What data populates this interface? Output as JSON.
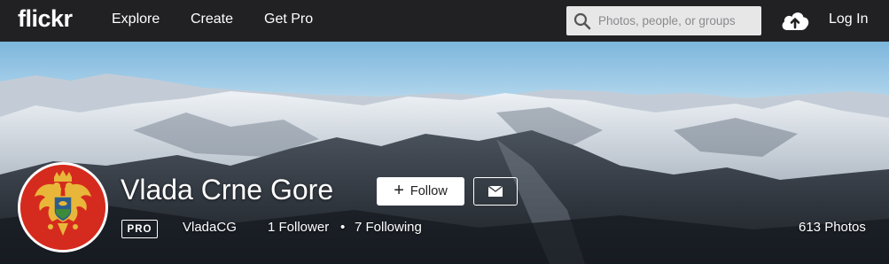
{
  "header": {
    "logo": "flickr",
    "nav": [
      {
        "label": "Explore"
      },
      {
        "label": "Create"
      },
      {
        "label": "Get Pro"
      }
    ],
    "search": {
      "placeholder": "Photos, people, or groups"
    },
    "login_label": "Log In"
  },
  "profile": {
    "display_name": "Vlada Crne Gore",
    "follow_label": "Follow",
    "pro_badge": "PRO",
    "username": "VladaCG",
    "followers": "1 Follower",
    "separator": "•",
    "following": "7 Following",
    "photos": "613 Photos"
  },
  "colors": {
    "topbar_bg": "#212124",
    "avatar_bg": "#d52b1e",
    "accent_gold": "#e8b73a"
  }
}
